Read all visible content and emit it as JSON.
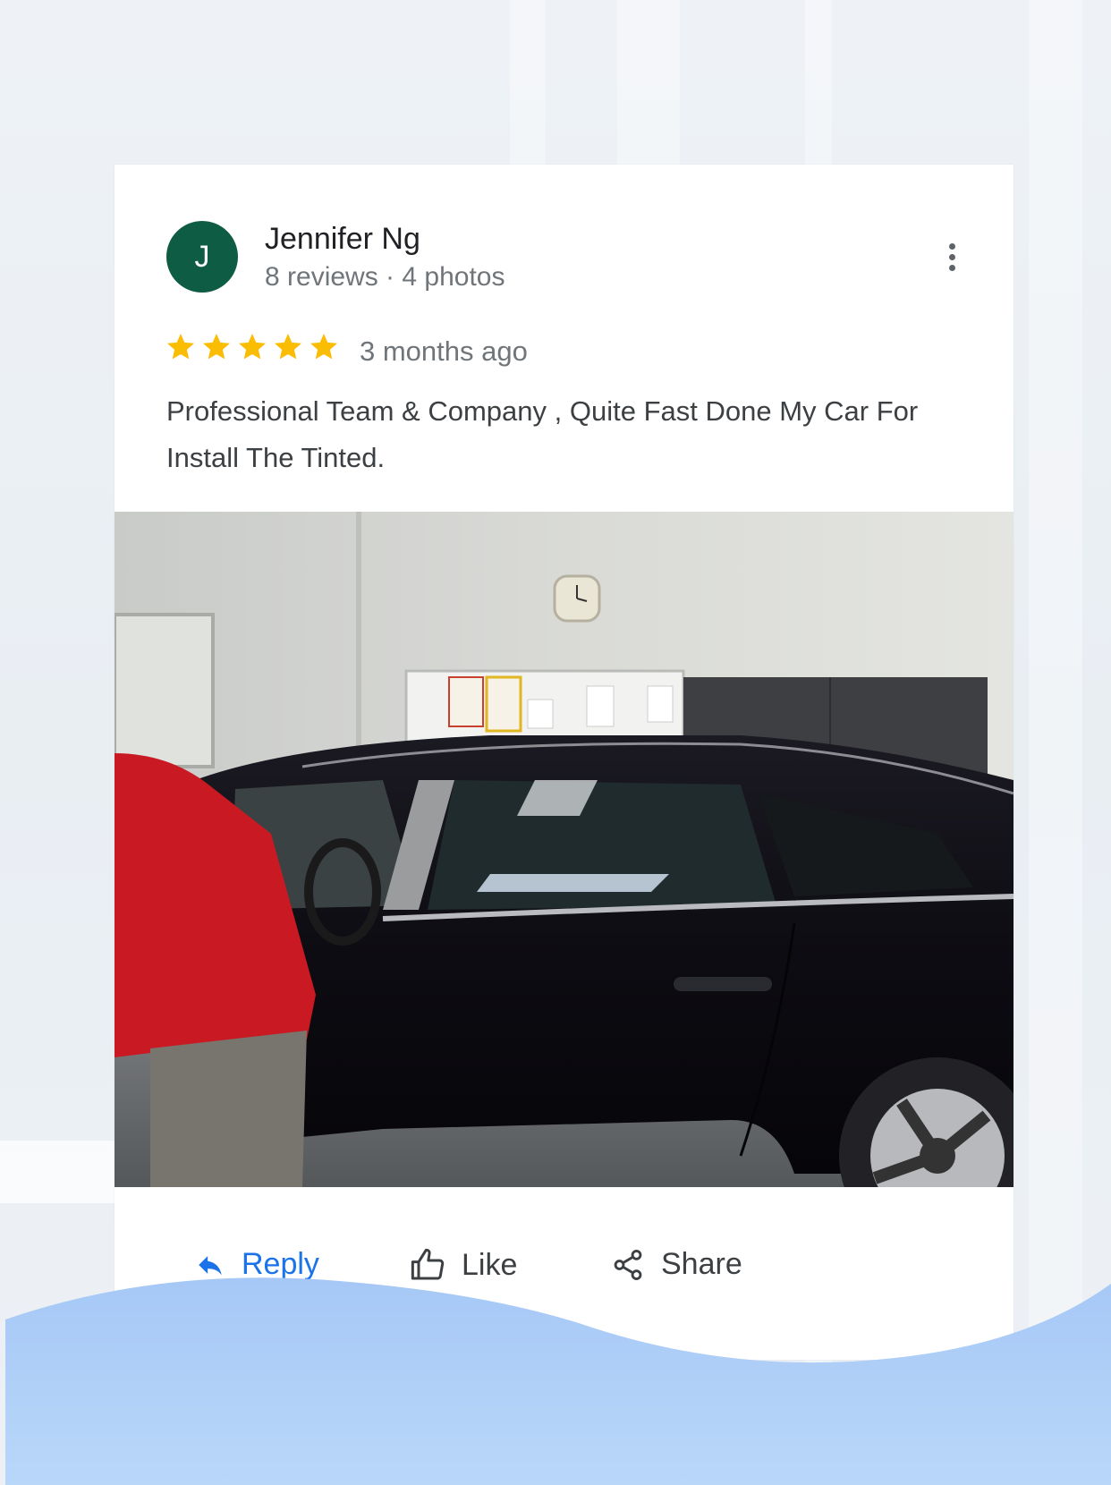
{
  "review": {
    "avatar_initial": "J",
    "author_name": "Jennifer Ng",
    "author_meta": "8 reviews · 4 photos",
    "rating": 5,
    "rating_max": 5,
    "time": "3 months ago",
    "text": "Professional Team & Company , Quite Fast Done My Car For Install The Tinted."
  },
  "actions": {
    "reply": "Reply",
    "like": "Like",
    "share": "Share"
  },
  "colors": {
    "avatar": "#0f5c44",
    "star": "#fbbc04",
    "reply": "#1a73e8",
    "wave": "#a9ccf7"
  },
  "icons": {
    "more": "more-vert-icon",
    "star": "star-icon",
    "reply": "reply-icon",
    "like": "thumb-up-icon",
    "share": "share-icon"
  }
}
